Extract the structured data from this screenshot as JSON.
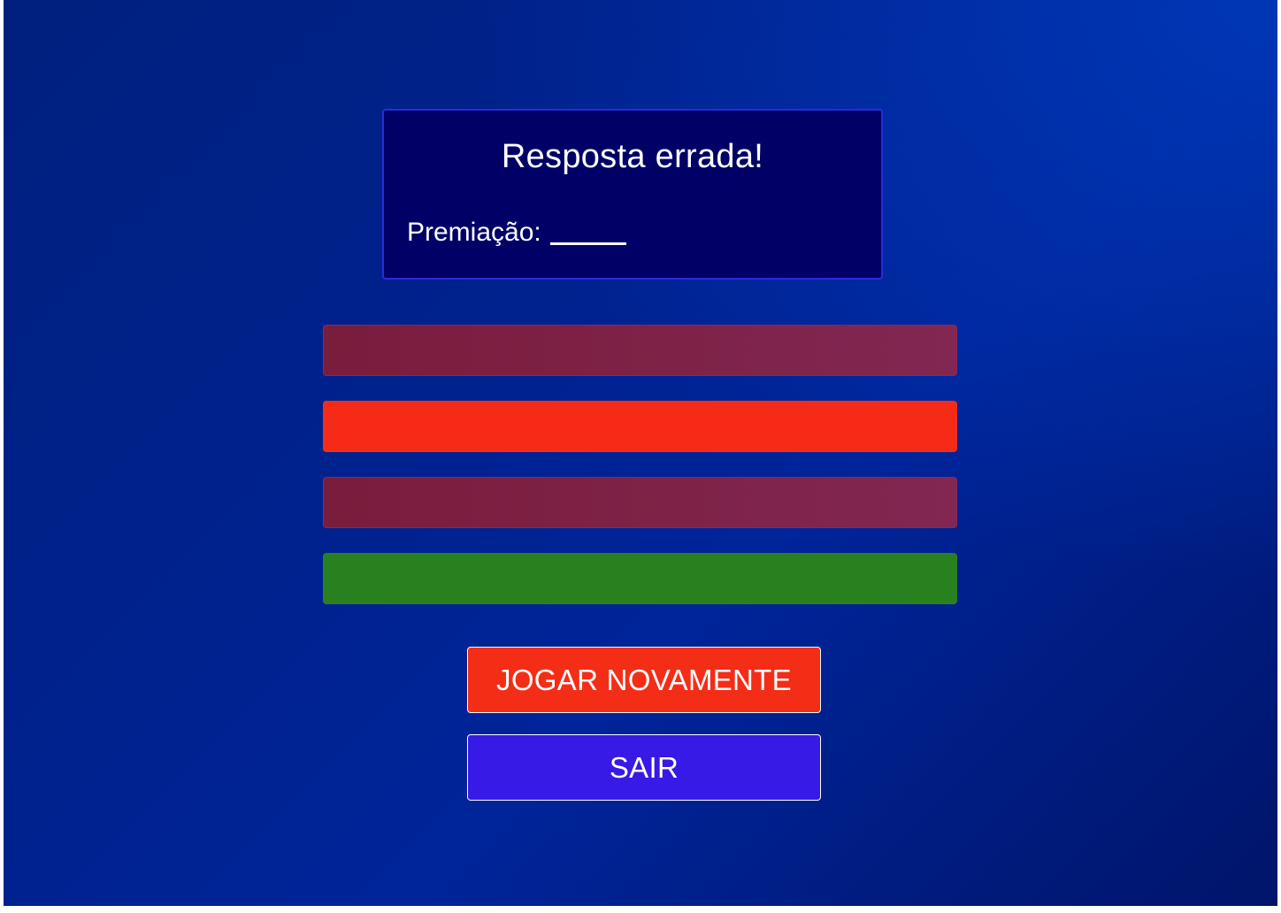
{
  "result": {
    "title": "Resposta errada!",
    "prize_label": "Premiação:"
  },
  "answers": [
    {
      "state": "dimmed",
      "color": "#7a1c3c"
    },
    {
      "state": "wrong",
      "color": "#f52b18"
    },
    {
      "state": "dimmed",
      "color": "#7a1c3c"
    },
    {
      "state": "correct",
      "color": "#28801e"
    }
  ],
  "buttons": {
    "play_again": "JOGAR NOVAMENTE",
    "exit": "SAIR"
  },
  "colors": {
    "background": "#00218a",
    "panel": "#000066",
    "play_again": "#f42d17",
    "exit": "#371ae6"
  }
}
